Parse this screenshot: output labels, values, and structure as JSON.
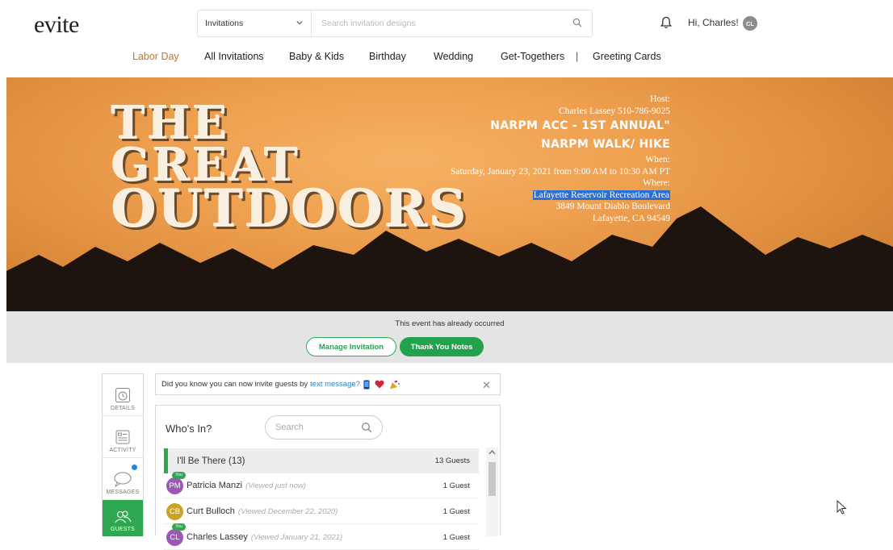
{
  "header": {
    "logo": "evite",
    "search_category": "Invitations",
    "search_placeholder": "Search invitation designs",
    "greeting": "Hi, Charles!",
    "avatar_initials": "CL"
  },
  "nav": {
    "items": [
      "Labor Day",
      "All Invitations",
      "Baby & Kids",
      "Birthday",
      "Wedding",
      "Get-Togethers",
      "|",
      "Greeting Cards"
    ]
  },
  "hero": {
    "title_lines": [
      "THE",
      "GREAT",
      "OUTDOORS"
    ],
    "host_label": "Host:",
    "host": "Charles Lassey 510-786-9025",
    "event_line1": "NARPM ACC - 1ST ANNUAL\"",
    "event_line2": "NARPM WALK/ HIKE",
    "when_label": "When:",
    "when": "Saturday, January 23, 2021 from 9:00 AM to 10:30 AM PT",
    "where_label": "Where:",
    "venue": "Lafayette Reservoir Recreation Area",
    "address1": "3849 Mount Diablo Boulevard",
    "address2": "Lafayette, CA 94549"
  },
  "status": {
    "text": "This event has already occurred",
    "manage_label": "Manage Invitation",
    "thanks_label": "Thank You Notes"
  },
  "rail": {
    "details": "DETAILS",
    "activity": "ACTIVITY",
    "messages": "MESSAGES",
    "guests": "GUESTS"
  },
  "tip": {
    "text": "Did you know you can now invite guests by",
    "link": "text message?"
  },
  "guests": {
    "title": "Who's In?",
    "search_placeholder": "Search",
    "group_label": "I'll Be There (13)",
    "group_count": "13 Guests",
    "you_badge": "You",
    "rows": [
      {
        "initials": "PM",
        "name": "Patricia Manzi",
        "note": "(Viewed just now)",
        "qty": "1 Guest",
        "color": "#9b59b6"
      },
      {
        "initials": "CB",
        "name": "Curt Bulloch",
        "note": "(Viewed December 22, 2020)",
        "qty": "1 Guest",
        "color": "#c9a227"
      },
      {
        "initials": "CL",
        "name": "Charles Lassey",
        "note": "(Viewed January 21, 2021)",
        "qty": "1 Guest",
        "color": "#9b59b6"
      }
    ]
  },
  "colors": {
    "brand_green": "#2fa650",
    "nav_highlight": "#c0742f",
    "selection_blue": "#2a6fd4"
  }
}
